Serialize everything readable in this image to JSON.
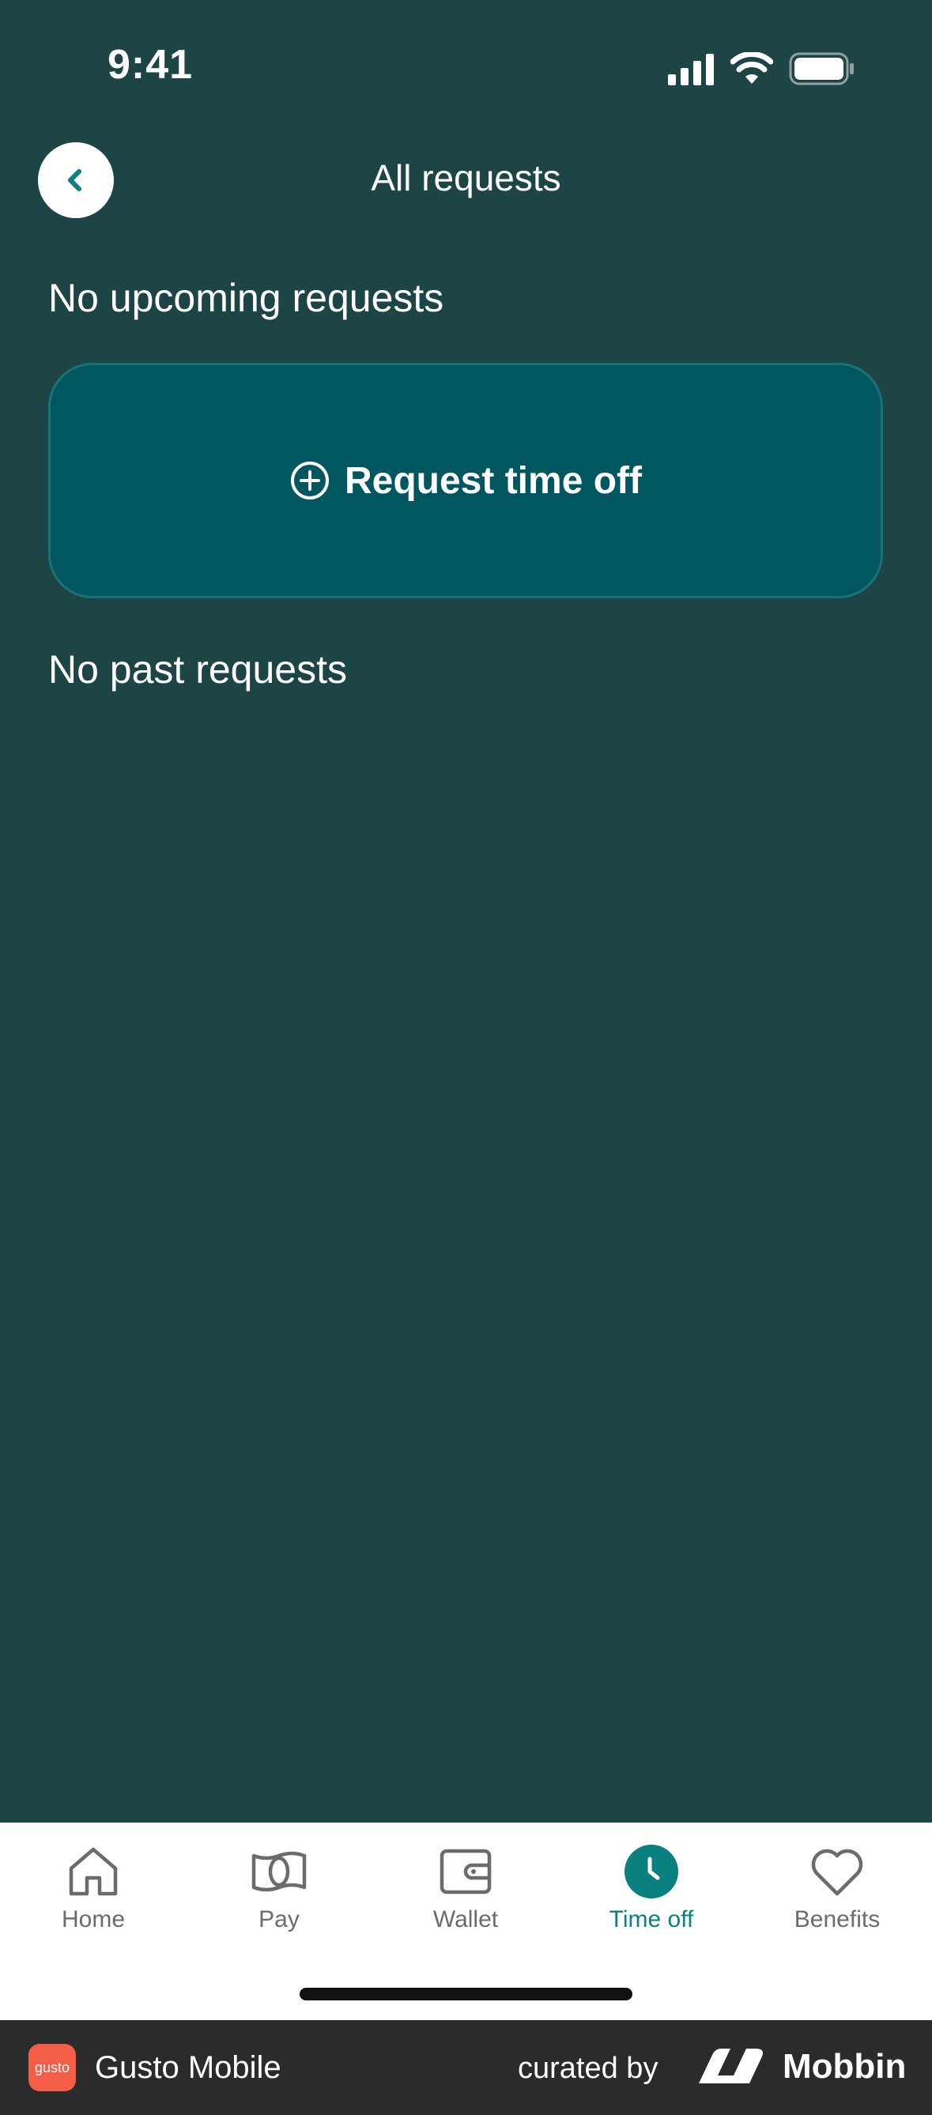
{
  "status_bar": {
    "time": "9:41"
  },
  "header": {
    "title": "All requests"
  },
  "upcoming": {
    "empty_text": "No upcoming requests"
  },
  "request_button": {
    "label": "Request time off"
  },
  "past": {
    "empty_text": "No past requests"
  },
  "tabs": [
    {
      "label": "Home",
      "icon": "home-icon",
      "active": false
    },
    {
      "label": "Pay",
      "icon": "pay-icon",
      "active": false
    },
    {
      "label": "Wallet",
      "icon": "wallet-icon",
      "active": false
    },
    {
      "label": "Time off",
      "icon": "clock-icon",
      "active": true
    },
    {
      "label": "Benefits",
      "icon": "heart-icon",
      "active": false
    }
  ],
  "footer": {
    "logo_text": "gusto",
    "app_name": "Gusto Mobile",
    "curated_by": "curated by",
    "brand": "Mobbin"
  },
  "colors": {
    "background": "#1e4546",
    "card": "#00575f",
    "accent": "#0a8080"
  }
}
